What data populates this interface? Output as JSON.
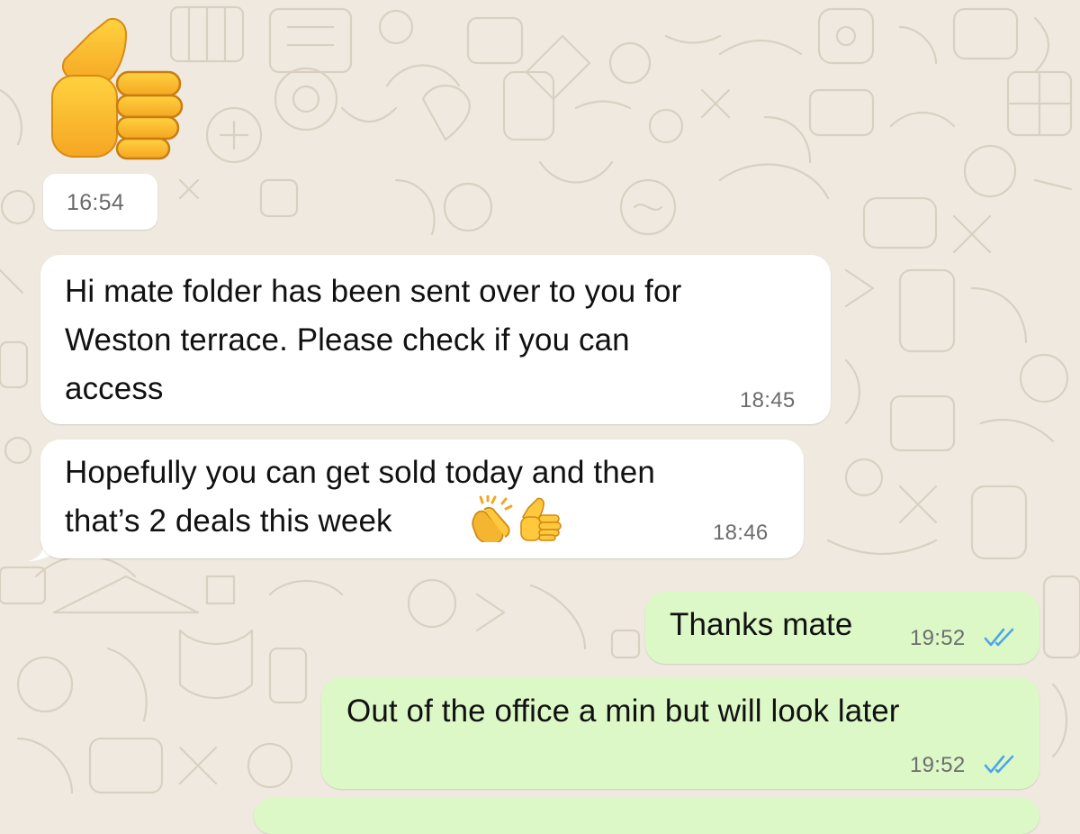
{
  "chat": {
    "wallpaper_icon": "doodle-pattern",
    "colors": {
      "wallpaper": "#efe9df",
      "incoming_bubble": "#ffffff",
      "outgoing_bubble": "#dcf8c6",
      "read_ticks": "#4fa6e6"
    },
    "messages": [
      {
        "direction": "incoming",
        "type": "emoji",
        "emoji_icon": "thumbs-up-emoji",
        "time": "16:54"
      },
      {
        "direction": "incoming",
        "lines": [
          "Hi mate folder has been sent over to you for",
          "Weston terrace. Please check if you can",
          "access"
        ],
        "time": "18:45"
      },
      {
        "direction": "incoming",
        "lines": [
          "Hopefully you can get sold today and then",
          "that’s 2 deals this week"
        ],
        "emojis": [
          "clapping-hands-emoji",
          "thumbs-up-emoji"
        ],
        "time": "18:46"
      },
      {
        "direction": "outgoing",
        "lines": [
          "Thanks mate"
        ],
        "time": "19:52",
        "status_icon": "read-double-tick-icon"
      },
      {
        "direction": "outgoing",
        "lines": [
          "Out of the office a min but will look later"
        ],
        "time": "19:52",
        "status_icon": "read-double-tick-icon"
      }
    ]
  }
}
